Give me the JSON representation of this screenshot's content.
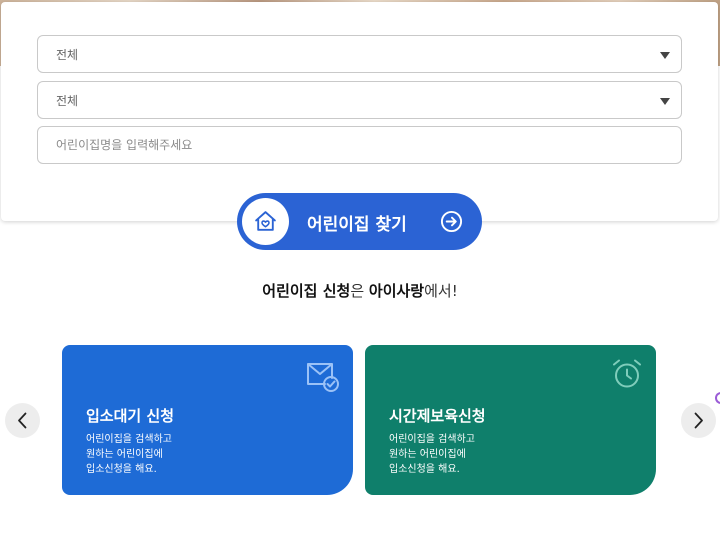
{
  "search": {
    "region_select": {
      "value": "전체"
    },
    "district_select": {
      "value": "전체"
    },
    "name_input": {
      "placeholder": "어린이집명을 입력해주세요"
    },
    "find_button": {
      "label": "어린이집 찾기",
      "icon": "house-heart-icon",
      "action_icon": "arrow-circle-right-icon"
    }
  },
  "tagline": {
    "part1": "어린이집 신청",
    "part2": "은 ",
    "part3": "아이사랑",
    "part4": "에서!"
  },
  "cards": [
    {
      "title": "입소대기 신청",
      "desc": [
        "어린이집을 검색하고",
        "원하는 어린이집에",
        "입소신청을 해요."
      ],
      "icon": "mail-check-icon",
      "color": "#1e6bd6"
    },
    {
      "title": "시간제보육신청",
      "desc": [
        "어린이집을 검색하고",
        "원하는 어린이집에",
        "입소신청을 해요."
      ],
      "icon": "alarm-clock-icon",
      "color": "#0f7f6b"
    }
  ],
  "carousel": {
    "prev_icon": "chevron-left-icon",
    "next_icon": "chevron-right-icon"
  },
  "colors": {
    "primary": "#2b63d4",
    "card_blue": "#1e6bd6",
    "card_green": "#0f7f6b"
  }
}
